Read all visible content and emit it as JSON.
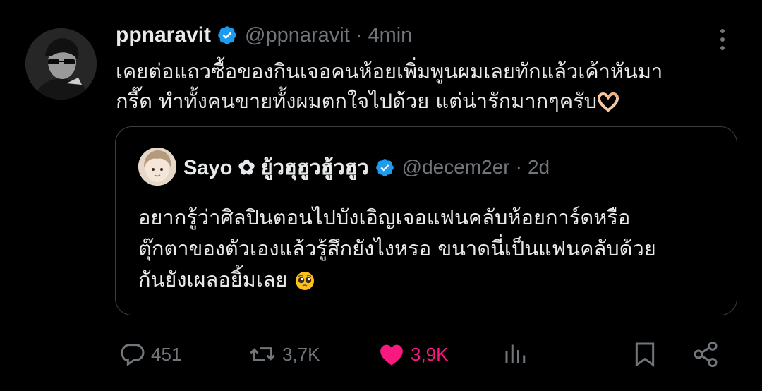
{
  "tweet": {
    "author_name": "ppnaravit",
    "author_handle": "@ppnaravit",
    "separator": "·",
    "time": "4min",
    "text_lines": [
      "เคยต่อแถวซื้อของกินเจอคนห้อยเพิ่มพูนผมเลยทักแล้วเค้าหันมา",
      "กรี๊ด ทำทั้งคนขายทั้งผมตกใจไปด้วย แต่น่ารักมากๆครับ"
    ],
    "text_emoji": "heart-hands"
  },
  "quote": {
    "author_name": "Sayo ✿ ยู้วฮุฮูวฮู้วฮูว",
    "author_handle": "@decem2er",
    "separator": "·",
    "time": "2d",
    "text_lines": [
      "อยากรู้ว่าศิลปินตอนไปบังเอิญเจอแฟนคลับห้อยการ์ดหรือ",
      "ตุ๊กตาของตัวเองแล้วรู้สึกยังไงหรอ ขนาดนี่เป็นแฟนคลับด้วย",
      "กันยังเผลอยิ้มเลย"
    ],
    "text_emoji": "pleading-face"
  },
  "actions": {
    "replies": "451",
    "reposts": "3,7K",
    "likes": "3,9K"
  },
  "icons": [
    "verified-badge-icon",
    "more-options-icon",
    "reply-icon",
    "repost-icon",
    "like-icon",
    "analytics-icon",
    "bookmark-icon",
    "share-icon"
  ],
  "colors": {
    "background": "#000000",
    "text": "#e7e9ea",
    "secondary": "#71767b",
    "verified": "#1d9bf0",
    "like": "#f91880",
    "border": "#3c4043"
  }
}
